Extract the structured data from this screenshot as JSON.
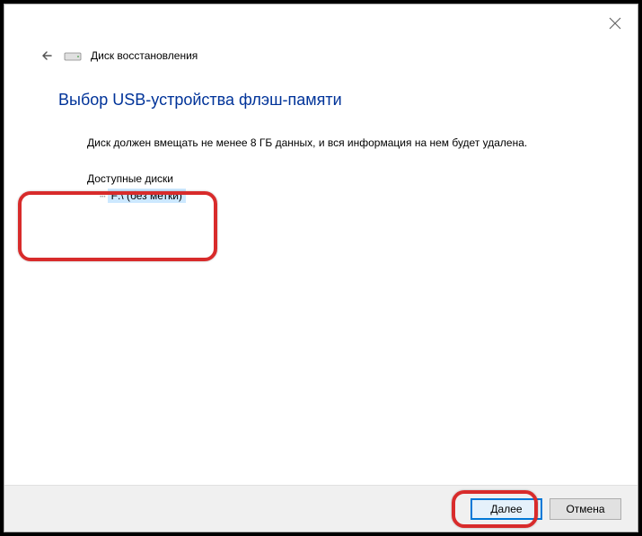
{
  "header": {
    "title": "Диск восстановления"
  },
  "content": {
    "page_title": "Выбор USB-устройства флэш-памяти",
    "description": "Диск должен вмещать не менее 8 ГБ данных, и вся информация на нем будет удалена.",
    "drives_label": "Доступные диски",
    "drives": [
      {
        "name": "F:\\ (без метки)"
      }
    ]
  },
  "footer": {
    "next_label": "Далее",
    "cancel_label": "Отмена"
  }
}
